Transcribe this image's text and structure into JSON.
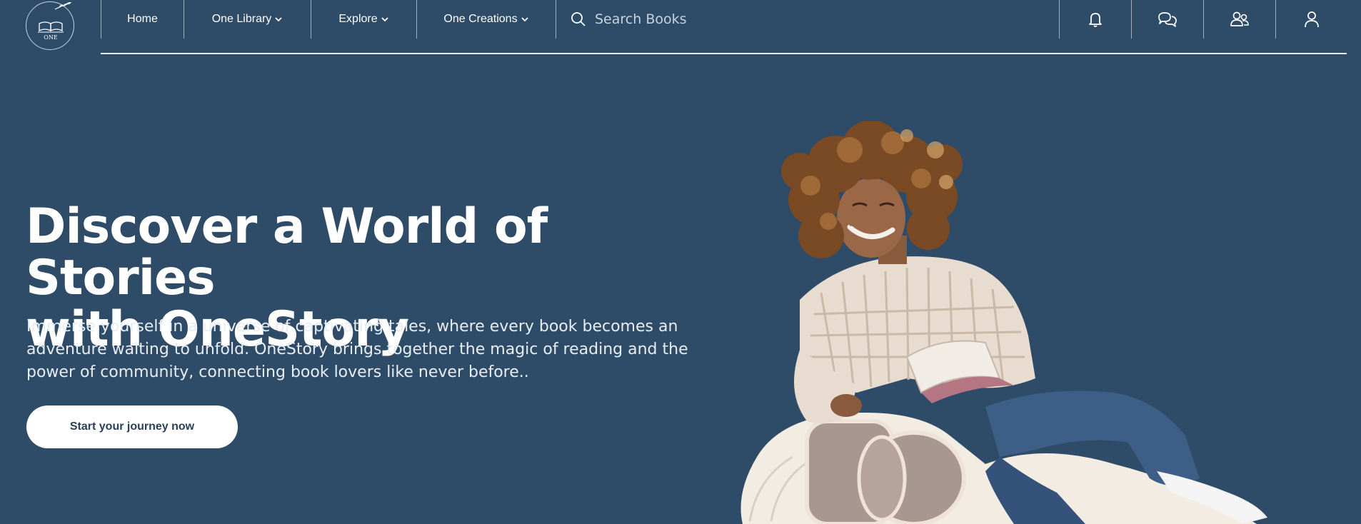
{
  "brand": {
    "logo_text": "ONE",
    "logo_icon": "open-book-icon"
  },
  "nav": {
    "home": "Home",
    "one_library": "One Library",
    "explore": "Explore",
    "one_creations": "One Creations"
  },
  "search": {
    "placeholder": "Search Books",
    "icon": "search-icon"
  },
  "header_icons": [
    "bell-icon",
    "chat-icon",
    "users-icon",
    "user-icon"
  ],
  "hero": {
    "title_line1": "Discover a World of Stories",
    "title_line2": "with OneStory",
    "subtitle": "Immerse yourself in a universe of captivating tales, where every book becomes an adventure waiting to unfold. OneStory brings together the magic of reading and the power of community, connecting book lovers like never before..",
    "cta_label": "Start your journey now"
  },
  "colors": {
    "background": "#2e4b68",
    "text": "#ffffff",
    "cta_text": "#2b3f55"
  }
}
